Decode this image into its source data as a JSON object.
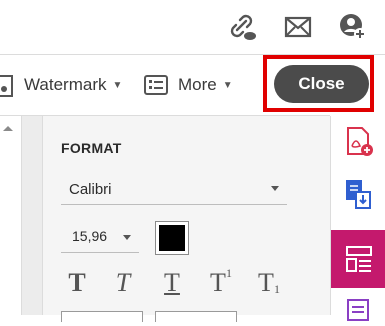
{
  "toolbar": {
    "watermark_label": "Watermark",
    "more_label": "More",
    "close_label": "Close"
  },
  "format_panel": {
    "title": "FORMAT",
    "font_family_value": "Calibri",
    "font_size_value": "15,96",
    "text_color": "#000000",
    "style_buttons": [
      "T",
      "T",
      "T",
      "T",
      "T"
    ],
    "superscript_label": "1",
    "subscript_label": "1"
  },
  "colors": {
    "highlight_red": "#e00000",
    "close_button": "#4b4b4b",
    "rail_active": "#c4196d",
    "rail_red": "#d9334d",
    "rail_blue": "#2f5fd0",
    "rail_purple": "#8a3fc4"
  },
  "icons": {
    "top": [
      "share-link-icon",
      "mail-icon",
      "add-user-icon"
    ],
    "rail": [
      "add-pdf-icon",
      "export-pdf-icon",
      "edit-pdf-icon",
      "comment-icon"
    ]
  }
}
